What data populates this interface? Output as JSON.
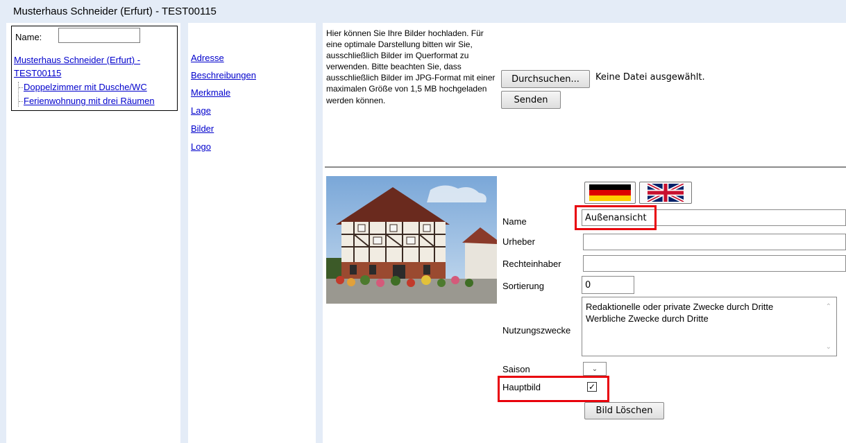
{
  "header": {
    "title": "Musterhaus Schneider (Erfurt) - TEST00115"
  },
  "tree": {
    "name_label": "Name:",
    "name_value": "",
    "root_link": "Musterhaus Schneider (Erfurt) - TEST00115",
    "children": [
      "Doppelzimmer mit Dusche/WC",
      "Ferienwohnung mit drei Räumen"
    ]
  },
  "nav": {
    "items": [
      "Adresse",
      "Beschreibungen",
      "Merkmale",
      "Lage",
      "Bilder",
      "Logo"
    ]
  },
  "upload": {
    "description": "Hier können Sie Ihre Bilder hochladen. Für eine optimale Darstellung bitten wir Sie, ausschließlich Bilder im Querformat zu verwenden. Bitte beachten Sie, dass ausschließlich Bilder im JPG-Format mit einer maximalen Größe von 1,5 MB hochgeladen werden können.",
    "browse_label": "Durchsuchen...",
    "no_file_text": "Keine Datei ausgewählt.",
    "send_label": "Senden"
  },
  "image_form": {
    "languages": [
      "de-flag-icon",
      "uk-flag-icon"
    ],
    "labels": {
      "name": "Name",
      "author": "Urheber",
      "rights_holder": "Rechteinhaber",
      "sort": "Sortierung",
      "usage": "Nutzungszwecke",
      "season": "Saison",
      "main_image": "Hauptbild"
    },
    "values": {
      "name": "Außenansicht",
      "author": "",
      "rights_holder": "",
      "sort": "0",
      "season": ""
    },
    "usage_options": [
      "Redaktionelle oder private Zwecke durch Dritte",
      "Werbliche Zwecke durch Dritte"
    ],
    "main_image_checked": true,
    "delete_label": "Bild Löschen"
  },
  "colors": {
    "highlight": "#e8000b",
    "panel_bg": "#e4ecf7",
    "link": "#0000cc"
  }
}
